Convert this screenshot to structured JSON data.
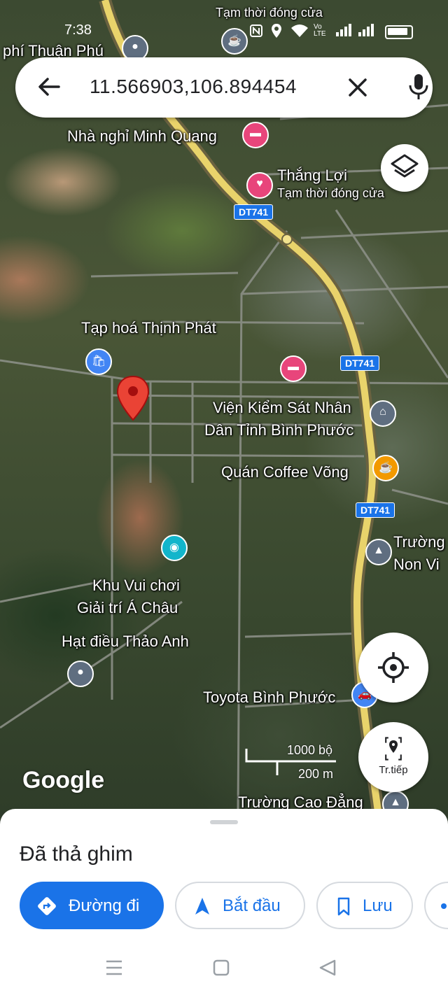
{
  "status_bar": {
    "time": "7:38",
    "icons": [
      "nfc-icon",
      "location-icon",
      "wifi-icon",
      "volte-icon",
      "signal-icon",
      "signal-icon",
      "battery-icon"
    ],
    "volte_text": "Vo LTE"
  },
  "search": {
    "query": "11.566903,106.894454"
  },
  "map": {
    "labels": {
      "thuan_phu": "phí Thuận Phú",
      "tam_thoi_top": "Tạm thời đóng cửa",
      "minh_quang": "Nhà nghỉ Minh Quang",
      "thang_loi": "Thắng Lợi",
      "thang_loi_status": "Tạm thời đóng cửa",
      "thinh_phat": "Tạp hoá Thịnh Phát",
      "vien_kiem_sat_1": "Viện Kiểm Sát Nhân",
      "vien_kiem_sat_2": "Dân Tỉnh Bình Phước",
      "coffee": "Quán Coffee Võng",
      "truong_non_1": "Trường",
      "truong_non_2": "Non Vi",
      "khu_vui_choi_1": "Khu Vui chơi",
      "khu_vui_choi_2": "Giải trí Á Châu",
      "hat_dieu": "Hạt điều Thảo Anh",
      "toyota": "Toyota Bình Phước",
      "cao_dang": "Trường Cao Đẳng"
    },
    "road_shields": [
      "DT741",
      "DT741",
      "DT741"
    ],
    "scale": {
      "feet": "1000 bộ",
      "meters": "200 m"
    },
    "logo": "Google",
    "navigate_label": "Tr.tiếp"
  },
  "sheet": {
    "title": "Đã thả ghim",
    "actions": [
      "Đường đi",
      "Bắt đầu",
      "Lưu"
    ]
  },
  "colors": {
    "accent": "#1a73e8",
    "pin": "#ea4335",
    "hotel_poi": "#e8457b",
    "cafe_poi": "#f29900",
    "gov_poi": "#5f6e80",
    "shop_poi": "#4285f4",
    "leisure_poi": "#12b5cb",
    "road_major": "#e9d36b"
  }
}
